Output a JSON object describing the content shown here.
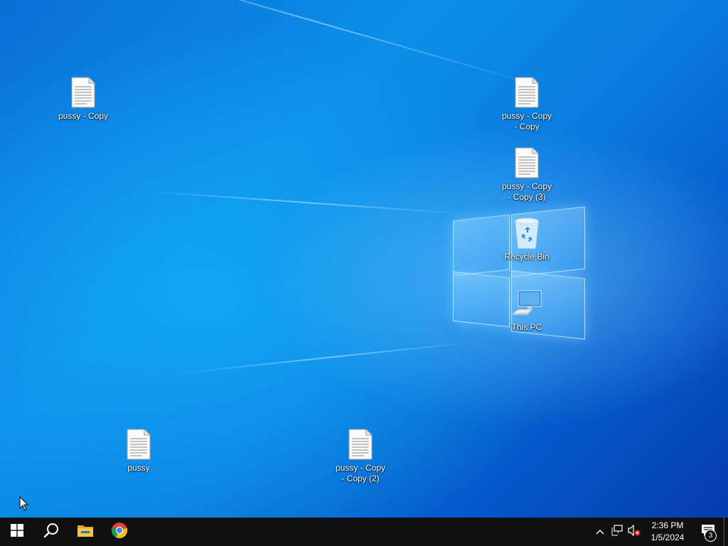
{
  "desktop": {
    "icons": [
      {
        "label": "pussy - Copy",
        "type": "text-file-icon"
      },
      {
        "label": "pussy - Copy - Copy",
        "type": "text-file-icon"
      },
      {
        "label": "pussy - Copy - Copy (3)",
        "type": "text-file-icon"
      },
      {
        "label": "Recycle Bin",
        "type": "recycle-bin-icon"
      },
      {
        "label": "This PC",
        "type": "computer-icon"
      },
      {
        "label": "pussy",
        "type": "text-file-icon"
      },
      {
        "label": "pussy - Copy - Copy (2)",
        "type": "text-file-icon"
      }
    ]
  },
  "taskbar": {
    "pinned": [
      "windows-start-icon",
      "search-icon",
      "file-explorer-icon",
      "chrome-icon"
    ],
    "tray": {
      "icons": [
        "chevron-up-icon",
        "network-icon",
        "volume-muted-icon"
      ],
      "time": "2:36 PM",
      "date": "1/5/2024",
      "notification_count": "3"
    }
  },
  "colors": {
    "taskbar": "#101010",
    "accent": "#0078d7"
  }
}
